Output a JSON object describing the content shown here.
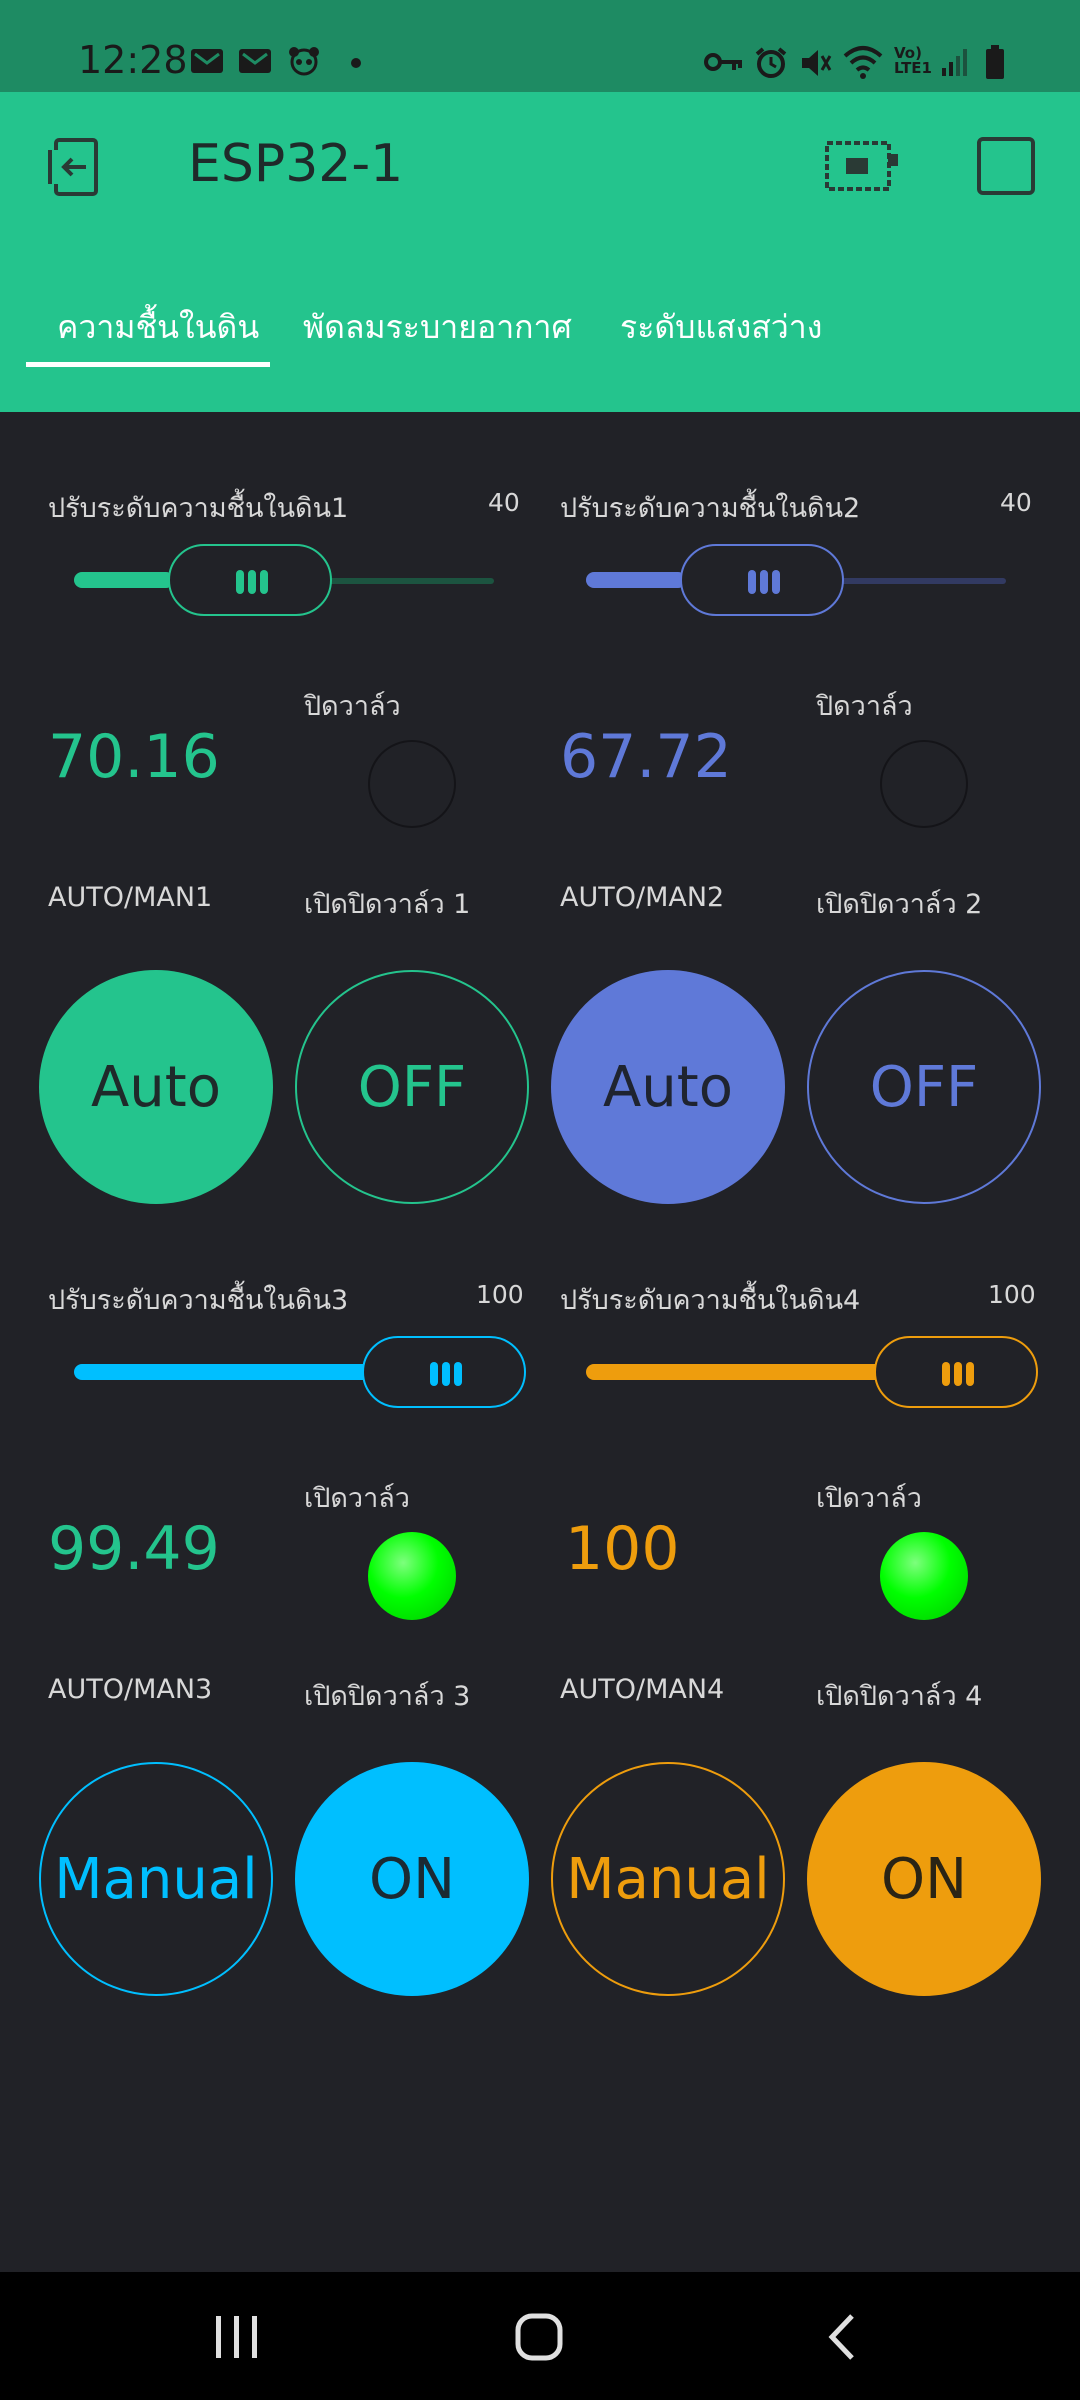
{
  "status_bar": {
    "time": "12:28",
    "network_label": "Vo) LTE1",
    "icons": [
      "gmail-icon",
      "gmail-icon",
      "panda-icon",
      "dot-icon",
      "key-icon",
      "alarm-icon",
      "mute-icon",
      "wifi-icon",
      "signal-icon",
      "battery-icon"
    ]
  },
  "header": {
    "title": "ESP32-1",
    "back_icon": "exit-icon",
    "device_icon": "board-icon",
    "settings_icon": "square-icon"
  },
  "tabs": [
    {
      "label": "ความชื้นในดิน",
      "active": true
    },
    {
      "label": "พัดลมระบายอากาศ",
      "active": false
    },
    {
      "label": "ระดับแสงสว่าง",
      "active": false
    }
  ],
  "colors": {
    "green": "#24c48d",
    "purple": "#5f79d8",
    "cyan": "#00bfff",
    "orange": "#ee9d0d",
    "led_on": "#00ff00",
    "background": "#212227"
  },
  "sliders": [
    {
      "label": "ปรับระดับความชื้นในดิน1",
      "value": "40",
      "fraction": 0.22
    },
    {
      "label": "ปรับระดับความชื้นในดิน2",
      "value": "40",
      "fraction": 0.22
    },
    {
      "label": "ปรับระดับความชื้นในดิน3",
      "value": "100",
      "fraction": 1.0
    },
    {
      "label": "ปรับระดับความชื้นในดิน4",
      "value": "100",
      "fraction": 1.0
    }
  ],
  "readings": [
    {
      "value": "70.16",
      "valve_label": "ปิดวาล์ว",
      "led_on": false
    },
    {
      "value": "67.72",
      "valve_label": "ปิดวาล์ว",
      "led_on": false
    },
    {
      "value": "99.49",
      "valve_label": "เปิดวาล์ว",
      "led_on": true
    },
    {
      "value": "100",
      "valve_label": "เปิดวาล์ว",
      "led_on": true
    }
  ],
  "controls": [
    {
      "mode_label": "AUTO/MAN1",
      "mode_value": "Auto",
      "valve_label": "เปิดปิดวาล์ว 1",
      "valve_value": "OFF"
    },
    {
      "mode_label": "AUTO/MAN2",
      "mode_value": "Auto",
      "valve_label": "เปิดปิดวาล์ว 2",
      "valve_value": "OFF"
    },
    {
      "mode_label": "AUTO/MAN3",
      "mode_value": "Manual",
      "valve_label": "เปิดปิดวาล์ว 3",
      "valve_value": "ON"
    },
    {
      "mode_label": "AUTO/MAN4",
      "mode_value": "Manual",
      "valve_label": "เปิดปิดวาล์ว 4",
      "valve_value": "ON"
    }
  ],
  "nav": {
    "recents_icon": "recents-icon",
    "home_icon": "home-icon",
    "back_icon": "back-icon"
  }
}
